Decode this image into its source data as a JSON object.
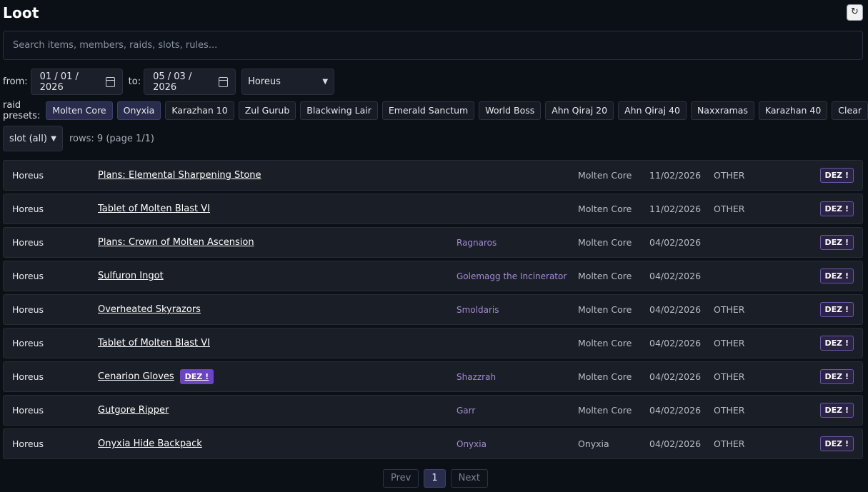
{
  "header": {
    "title": "Loot",
    "refresh_icon": "↻"
  },
  "search": {
    "placeholder": "Search items, members, raids, slots, rules..."
  },
  "filters": {
    "from_label": "from:",
    "from_value": "01 / 01 / 2026",
    "to_label": "to:",
    "to_value": "05 / 03 / 2026",
    "member_select": "Horeus"
  },
  "presets": {
    "label": "raid presets:",
    "items": [
      {
        "label": "Molten Core",
        "active": true
      },
      {
        "label": "Onyxia",
        "active": true
      },
      {
        "label": "Karazhan 10",
        "active": false
      },
      {
        "label": "Zul Gurub",
        "active": false
      },
      {
        "label": "Blackwing Lair",
        "active": false
      },
      {
        "label": "Emerald Sanctum",
        "active": false
      },
      {
        "label": "World Boss",
        "active": false
      },
      {
        "label": "Ahn Qiraj 20",
        "active": false
      },
      {
        "label": "Ahn Qiraj 40",
        "active": false
      },
      {
        "label": "Naxxramas",
        "active": false
      },
      {
        "label": "Karazhan 40",
        "active": false
      },
      {
        "label": "Clear",
        "active": false
      }
    ]
  },
  "slot": {
    "select": "slot (all)",
    "rows_text": "rows: 9 (page 1/1)"
  },
  "rows": [
    {
      "member": "Horeus",
      "item": "Plans: Elemental Sharpening Stone",
      "boss": "",
      "raid": "Molten Core",
      "date": "11/02/2026",
      "note": "OTHER",
      "action": "DEZ !",
      "badge": ""
    },
    {
      "member": "Horeus",
      "item": "Tablet of Molten Blast VI",
      "boss": "",
      "raid": "Molten Core",
      "date": "11/02/2026",
      "note": "OTHER",
      "action": "DEZ !",
      "badge": ""
    },
    {
      "member": "Horeus",
      "item": "Plans: Crown of Molten Ascension",
      "boss": "Ragnaros",
      "raid": "Molten Core",
      "date": "04/02/2026",
      "note": "",
      "action": "DEZ !",
      "badge": ""
    },
    {
      "member": "Horeus",
      "item": "Sulfuron Ingot",
      "boss": "Golemagg the Incinerator",
      "raid": "Molten Core",
      "date": "04/02/2026",
      "note": "",
      "action": "DEZ !",
      "badge": ""
    },
    {
      "member": "Horeus",
      "item": "Overheated Skyrazors",
      "boss": "Smoldaris",
      "raid": "Molten Core",
      "date": "04/02/2026",
      "note": "OTHER",
      "action": "DEZ !",
      "badge": ""
    },
    {
      "member": "Horeus",
      "item": "Tablet of Molten Blast VI",
      "boss": "",
      "raid": "Molten Core",
      "date": "04/02/2026",
      "note": "OTHER",
      "action": "DEZ !",
      "badge": ""
    },
    {
      "member": "Horeus",
      "item": "Cenarion Gloves",
      "boss": "Shazzrah",
      "raid": "Molten Core",
      "date": "04/02/2026",
      "note": "OTHER",
      "action": "DEZ !",
      "badge": "DEZ !"
    },
    {
      "member": "Horeus",
      "item": "Gutgore Ripper",
      "boss": "Garr",
      "raid": "Molten Core",
      "date": "04/02/2026",
      "note": "OTHER",
      "action": "DEZ !",
      "badge": ""
    },
    {
      "member": "Horeus",
      "item": "Onyxia Hide Backpack",
      "boss": "Onyxia",
      "raid": "Onyxia",
      "date": "04/02/2026",
      "note": "OTHER",
      "action": "DEZ !",
      "badge": ""
    }
  ],
  "pager": {
    "prev": "Prev",
    "current": "1",
    "next": "Next"
  }
}
